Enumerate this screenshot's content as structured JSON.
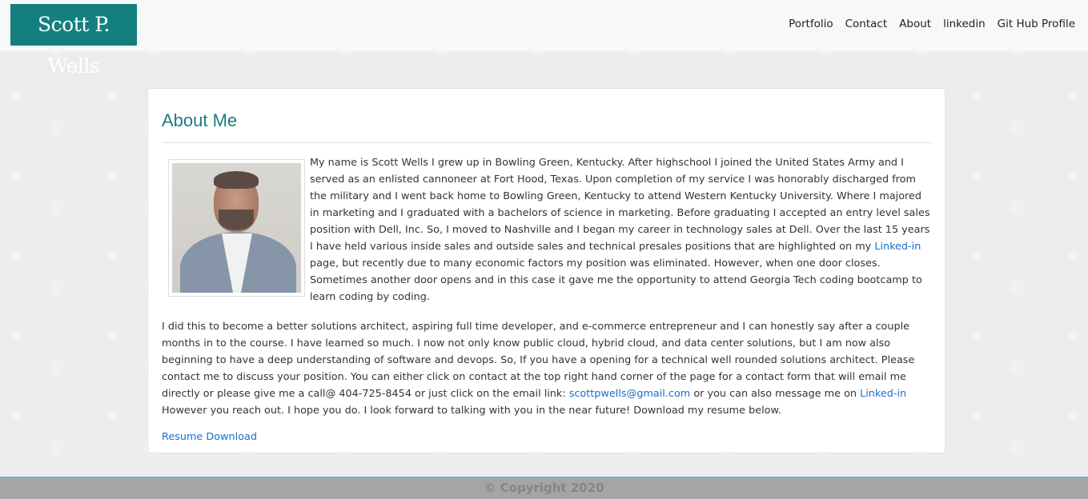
{
  "header": {
    "brand": "Scott P. Wells",
    "nav": [
      "Portfolio",
      "Contact",
      "About",
      "linkedin",
      "Git Hub Profile"
    ]
  },
  "about": {
    "title": "About Me",
    "photo_alt": "Scott P. Wells photo",
    "p1_a": "My name is Scott Wells I grew up in Bowling Green, Kentucky. After highschool I joined the United States Army and I served as an enlisted cannoneer at Fort Hood, Texas. Upon completion of my service I was honorably discharged from the military and I went back home to Bowling Green, Kentucky to attend Western Kentucky University. Where I majored in marketing and I graduated with a bachelors of science in marketing. Before graduating I accepted an entry level sales position with Dell, Inc. So, I moved to Nashville and I began my career in technology sales at Dell. Over the last 15 years I have held various inside sales and outside sales and technical presales positions that are highlighted on my ",
    "p1_link": "Linked-in",
    "p1_b": " page, but recently due to many economic factors my position was eliminated. However, when one door closes. Sometimes another door opens and in this case it gave me the opportunity to attend Georgia Tech coding bootcamp to learn coding by coding.",
    "p2_a": "I did this to become a better solutions architect, aspiring full time developer, and e-commerce entrepreneur and I can honestly say after a couple months in to the course. I have learned so much. I now not only know public cloud, hybrid cloud, and data center solutions, but I am now also beginning to have a deep understanding of software and devops. So, If you have a opening for a technical well rounded solutions architect. Please contact me to discuss your position. You can either click on contact at the top right hand corner of the page for a contact form that will email me directly or please give me a call@ 404-725-8454 or just click on the email link: ",
    "p2_email": "scottpwells@gmail.com",
    "p2_b": " or you can also message me on ",
    "p2_link": "Linked-in",
    "p2_c": " However you reach out. I hope you do. I look forward to talking with you in the near future! Download my resume below.",
    "resume": "Resume Download"
  },
  "footer": {
    "copyright": "© Copyright 2020"
  },
  "colors": {
    "brand_bg": "#137f7f",
    "title": "#1d7a80",
    "link": "#1a6fc7",
    "footer_bg": "#a5a5a5"
  }
}
